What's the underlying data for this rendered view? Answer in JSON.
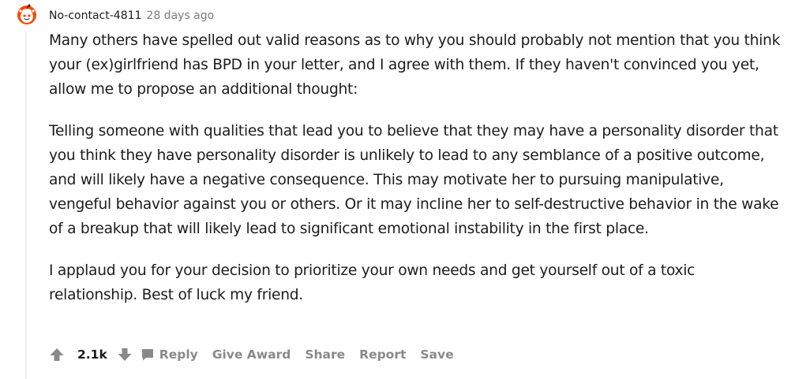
{
  "comment": {
    "author": "No-contact-4811",
    "time": "28 days ago",
    "paragraphs": [
      "Many others have spelled out valid reasons as to why you should probably not mention that you think your (ex)girlfriend has BPD in your letter, and I agree with them. If they haven't convinced you yet, allow me to propose an additional thought:",
      "Telling someone with qualities that lead you to believe that they may have a personality disorder that you think they have personality disorder is unlikely to lead to any semblance of a positive outcome, and will likely have a negative consequence. This may motivate her to pursuing manipulative, vengeful behavior against you or others. Or it may incline her to self-destructive behavior in the wake of a breakup that will likely lead to significant emotional instability in the first place.",
      "I applaud you for your decision to prioritize your own needs and get yourself out of a toxic relationship. Best of luck my friend."
    ]
  },
  "actions": {
    "score": "2.1k",
    "reply": "Reply",
    "give_award": "Give Award",
    "share": "Share",
    "report": "Report",
    "save": "Save"
  },
  "icons": {
    "avatar": "snoo-avatar-icon",
    "upvote": "upvote-arrow-icon",
    "downvote": "downvote-arrow-icon",
    "reply": "comment-bubble-icon"
  },
  "colors": {
    "avatar_accent": "#ff4500",
    "text": "#1c1c1c",
    "meta": "#7c7c7c",
    "action": "#878a8c"
  }
}
